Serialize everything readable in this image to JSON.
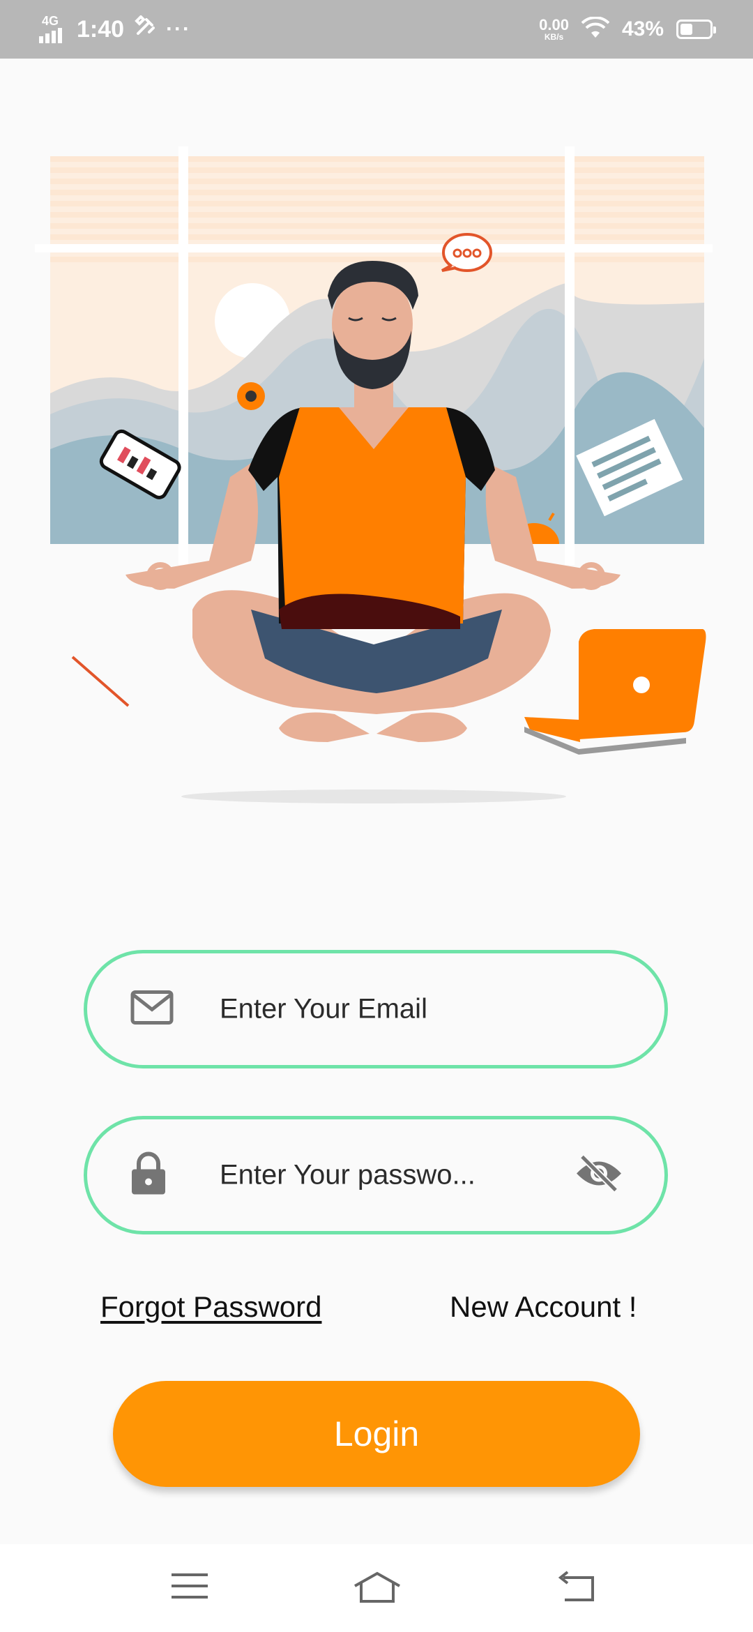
{
  "status_bar": {
    "network": "4G",
    "time": "1:40",
    "tools_icon": "tools-icon",
    "more": "···",
    "speed_value": "0.00",
    "speed_unit": "KB/s",
    "battery_percent": "43%",
    "battery_level": 0.43
  },
  "illustration": {
    "subject": "meditating-man-illustration",
    "accent_color": "#ff7f00"
  },
  "form": {
    "email_placeholder": "Enter Your Email",
    "email_icon": "mail-icon",
    "password_placeholder": "Enter Your passwo...",
    "password_icon": "lock-icon",
    "visibility_icon": "eye-off-icon",
    "border_color": "#6ee3a8"
  },
  "links": {
    "forgot_password": "Forgot Password",
    "new_account": "New Account !"
  },
  "login_button": {
    "label": "Login",
    "color": "#ff9505"
  },
  "nav_bar": {
    "menu_icon": "menu-icon",
    "home_icon": "home-icon",
    "back_icon": "back-icon"
  }
}
